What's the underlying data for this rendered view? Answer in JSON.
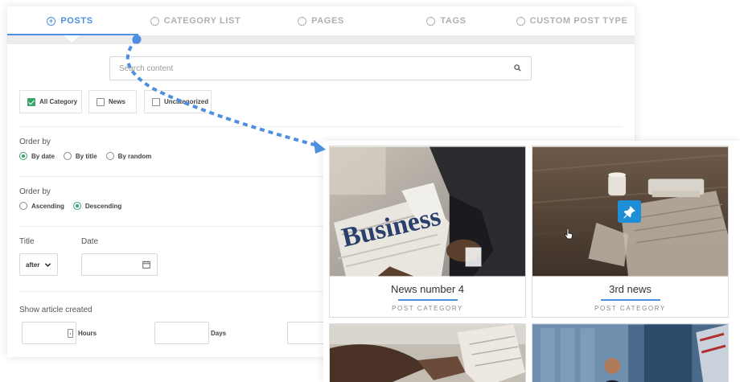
{
  "tabs": [
    {
      "label": "POSTS",
      "icon": "plus-circle-icon",
      "active": true
    },
    {
      "label": "CATEGORY LIST",
      "icon": "radio-circle-icon",
      "active": false
    },
    {
      "label": "PAGES",
      "icon": "radio-circle-icon",
      "active": false
    },
    {
      "label": "TAGS",
      "icon": "radio-circle-icon",
      "active": false
    },
    {
      "label": "CUSTOM POST TYPE",
      "icon": "radio-circle-icon",
      "active": false
    }
  ],
  "search": {
    "placeholder": "Search content",
    "icon": "search-icon"
  },
  "categories": [
    {
      "label": "All Category",
      "checked": true
    },
    {
      "label": "News",
      "checked": false
    },
    {
      "label": "Uncategorized",
      "checked": false
    }
  ],
  "order_by_1": {
    "label": "Order by",
    "options": [
      {
        "label": "By date",
        "selected": true
      },
      {
        "label": "By title",
        "selected": false
      },
      {
        "label": "By random",
        "selected": false
      }
    ]
  },
  "order_by_2": {
    "label": "Order by",
    "options": [
      {
        "label": "Ascending",
        "selected": false
      },
      {
        "label": "Descending",
        "selected": true
      }
    ]
  },
  "title_field": {
    "label": "Title",
    "value": "after"
  },
  "date_field": {
    "label": "Date",
    "icon": "calendar-icon"
  },
  "show_article": {
    "label": "Show article created",
    "units": [
      "Hours",
      "Days"
    ]
  },
  "cards": [
    {
      "title": "News number 4",
      "category": "POST CATEGORY"
    },
    {
      "title": "3rd news",
      "category": "POST CATEGORY",
      "pinned": true
    }
  ],
  "colors": {
    "accent": "#4d8fe0",
    "check": "#3aa56b",
    "pin": "#1e8fd6"
  }
}
